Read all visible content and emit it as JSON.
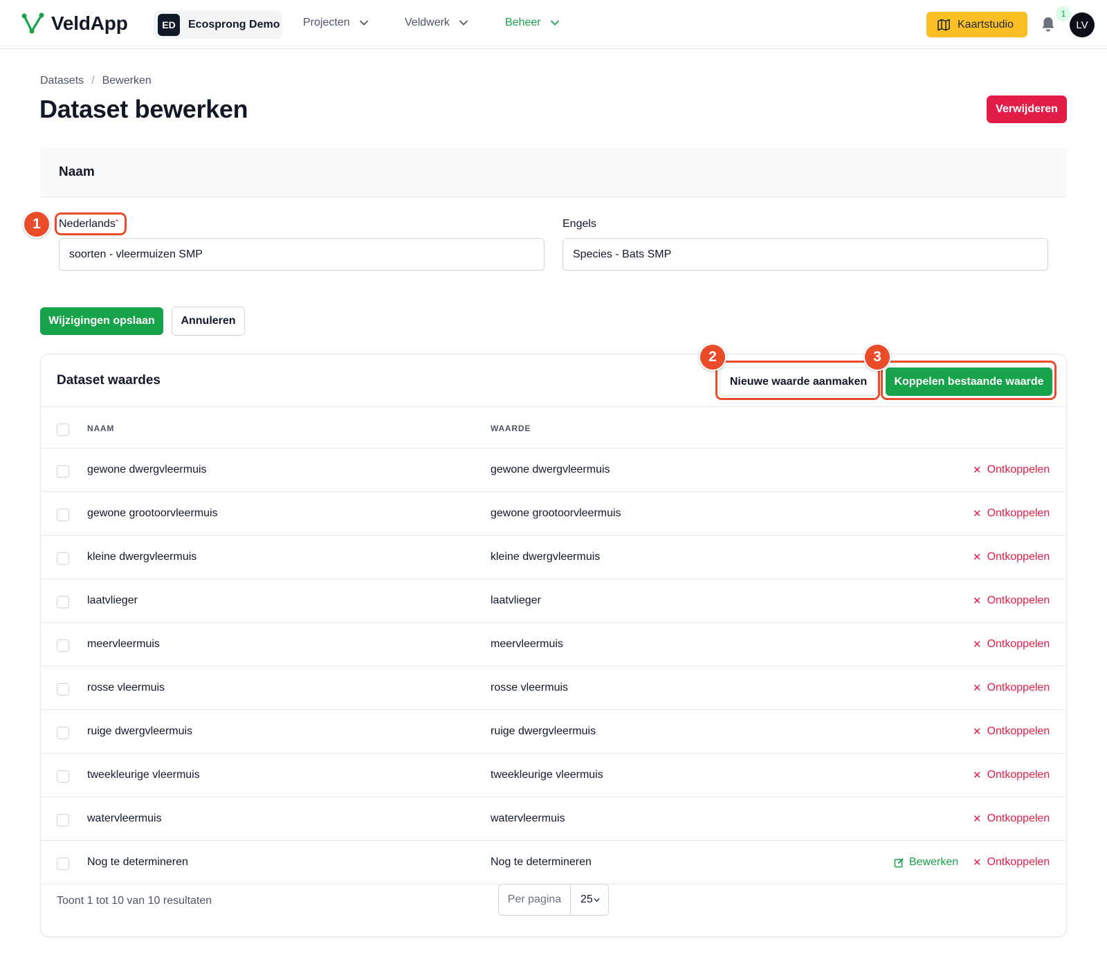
{
  "app": {
    "name": "VeldApp",
    "team_initials": "ED",
    "team_name": "Ecosprong Demo",
    "nav": [
      {
        "label": "Projecten",
        "active": false
      },
      {
        "label": "Veldwerk",
        "active": false
      },
      {
        "label": "Beheer",
        "active": true
      }
    ],
    "kaartstudio_label": "Kaartstudio",
    "notification_count": "1",
    "user_initials": "LV"
  },
  "breadcrumb": [
    "Datasets",
    "/",
    "Bewerken"
  ],
  "page": {
    "title": "Dataset bewerken",
    "delete_label": "Verwijderen"
  },
  "name_section": {
    "title": "Naam",
    "nl_label": "Nederlands",
    "nl_required": "*",
    "nl_value": "soorten - vleermuizen SMP",
    "en_label": "Engels",
    "en_value": "Species - Bats SMP"
  },
  "actions": {
    "save_label": "Wijzigingen opslaan",
    "cancel_label": "Annuleren"
  },
  "callouts": [
    "1",
    "2",
    "3"
  ],
  "values_card": {
    "title": "Dataset waardes",
    "new_label": "Nieuwe waarde aanmaken",
    "link_label": "Koppelen bestaande waarde",
    "col_naam": "NAAM",
    "col_waarde": "WAARDE",
    "unlink_label": "Ontkoppelen",
    "edit_label": "Bewerken",
    "rows": [
      {
        "naam": "gewone dwergvleermuis",
        "waarde": "gewone dwergvleermuis"
      },
      {
        "naam": "gewone grootoorvleermuis",
        "waarde": "gewone grootoorvleermuis"
      },
      {
        "naam": "kleine dwergvleermuis",
        "waarde": "kleine dwergvleermuis"
      },
      {
        "naam": "laatvlieger",
        "waarde": "laatvlieger"
      },
      {
        "naam": "meervleermuis",
        "waarde": "meervleermuis"
      },
      {
        "naam": "rosse vleermuis",
        "waarde": "rosse vleermuis"
      },
      {
        "naam": "ruige dwergvleermuis",
        "waarde": "ruige dwergvleermuis"
      },
      {
        "naam": "tweekleurige vleermuis",
        "waarde": "tweekleurige vleermuis"
      },
      {
        "naam": "watervleermuis",
        "waarde": "watervleermuis"
      },
      {
        "naam": "Nog te determineren",
        "waarde": "Nog te determineren"
      }
    ],
    "result_text": "Toont 1 tot 10 van 10 resultaten",
    "per_page_label": "Per pagina",
    "per_page_value": "25"
  },
  "colors": {
    "brand_green": "#16a34a",
    "danger": "#e11d48",
    "accent_yellow": "#fbbf24",
    "callout": "#ea4b29"
  }
}
